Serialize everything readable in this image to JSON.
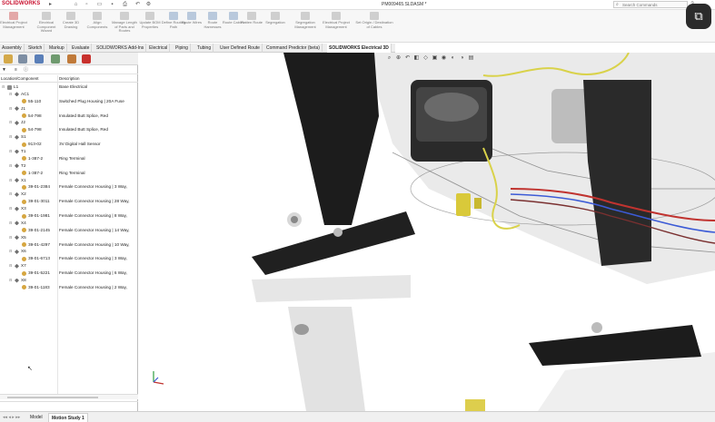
{
  "app": {
    "logo": "SOLIDWORKS",
    "document_title": "PM009465.SLDASM *",
    "search_placeholder": "Search Commands"
  },
  "ribbon": {
    "buttons": [
      {
        "label": "Electrical Project Management",
        "state": "disabled"
      },
      {
        "label": "Electrical Component Wizard",
        "state": "disabled"
      },
      {
        "label": "Create 3D Drawing",
        "state": "disabled"
      },
      {
        "label": "Align Components",
        "state": "disabled"
      },
      {
        "label": "Manage Length of Parts and Routes",
        "state": "disabled"
      },
      {
        "label": "Update BOM Properties",
        "state": "disabled"
      },
      {
        "label": "Define Routing Path",
        "state": "disabled"
      },
      {
        "label": "Route Wires",
        "state": "disabled"
      },
      {
        "label": "Route Harnesses",
        "state": "disabled"
      },
      {
        "label": "Route Cables",
        "state": "disabled"
      },
      {
        "label": "Flatten Route",
        "state": "disabled"
      },
      {
        "label": "Segregation",
        "state": "disabled"
      },
      {
        "label": "Segregation Management",
        "state": "disabled"
      },
      {
        "label": "Electrical Project Management",
        "state": "disabled"
      },
      {
        "label": "Set Origin / Destination of Cables",
        "state": "disabled"
      }
    ]
  },
  "tabs": [
    {
      "label": "Assembly"
    },
    {
      "label": "Sketch"
    },
    {
      "label": "Markup"
    },
    {
      "label": "Evaluate"
    },
    {
      "label": "SOLIDWORKS Add-Ins"
    },
    {
      "label": "Electrical"
    },
    {
      "label": "Piping"
    },
    {
      "label": "Tubing"
    },
    {
      "label": "User Defined Route"
    },
    {
      "label": "Command Predictor (beta)"
    },
    {
      "label": "SOLIDWORKS Electrical 3D",
      "active": true
    }
  ],
  "tree": {
    "col_location": "Location/Component",
    "col_description": "Description",
    "rows": [
      {
        "level": 0,
        "kind": "asm",
        "loc": "L1",
        "desc": "Base Electrical"
      },
      {
        "level": 1,
        "kind": "conn",
        "loc": "AC1",
        "desc": ""
      },
      {
        "level": 2,
        "kind": "part",
        "loc": "55-110",
        "desc": "Switched Plug Housing | 20A Fuse"
      },
      {
        "level": 1,
        "kind": "conn",
        "loc": "J1",
        "desc": ""
      },
      {
        "level": 2,
        "kind": "part",
        "loc": "54-798",
        "desc": "Insulated Butt Splice, Red"
      },
      {
        "level": 1,
        "kind": "conn",
        "loc": "J2",
        "desc": ""
      },
      {
        "level": 2,
        "kind": "part",
        "loc": "54-798",
        "desc": "Insulated Butt Splice, Red"
      },
      {
        "level": 1,
        "kind": "conn",
        "loc": "S1",
        "desc": ""
      },
      {
        "level": 2,
        "kind": "part",
        "loc": "913-02",
        "desc": "3V Digital Hall Sensor"
      },
      {
        "level": 1,
        "kind": "conn",
        "loc": "T1",
        "desc": ""
      },
      {
        "level": 2,
        "kind": "part",
        "loc": "1-387-2",
        "desc": "Ring Terminal"
      },
      {
        "level": 1,
        "kind": "conn",
        "loc": "T2",
        "desc": ""
      },
      {
        "level": 2,
        "kind": "part",
        "loc": "1-387-2",
        "desc": "Ring Terminal"
      },
      {
        "level": 1,
        "kind": "conn",
        "loc": "X1",
        "desc": ""
      },
      {
        "level": 2,
        "kind": "part",
        "loc": "39-01-2384",
        "desc": "Female Connector Housing | 3 Way,"
      },
      {
        "level": 1,
        "kind": "conn",
        "loc": "X2",
        "desc": ""
      },
      {
        "level": 2,
        "kind": "part",
        "loc": "39-01-3011",
        "desc": "Female Connector Housing | 28 Way,"
      },
      {
        "level": 1,
        "kind": "conn",
        "loc": "X3",
        "desc": ""
      },
      {
        "level": 2,
        "kind": "part",
        "loc": "39-01-1981",
        "desc": "Female Connector Housing | 8 Way,"
      },
      {
        "level": 1,
        "kind": "conn",
        "loc": "X4",
        "desc": ""
      },
      {
        "level": 2,
        "kind": "part",
        "loc": "39-01-2145",
        "desc": "Female Connector Housing | 14 Way,"
      },
      {
        "level": 1,
        "kind": "conn",
        "loc": "X5",
        "desc": ""
      },
      {
        "level": 2,
        "kind": "part",
        "loc": "39-01-4297",
        "desc": "Female Connector Housing | 10 Way,"
      },
      {
        "level": 1,
        "kind": "conn",
        "loc": "X6",
        "desc": ""
      },
      {
        "level": 2,
        "kind": "part",
        "loc": "39-01-6713",
        "desc": "Female Connector Housing | 3 Way,"
      },
      {
        "level": 1,
        "kind": "conn",
        "loc": "X7",
        "desc": ""
      },
      {
        "level": 2,
        "kind": "part",
        "loc": "39-01-5221",
        "desc": "Female Connector Housing | 6 Way,"
      },
      {
        "level": 1,
        "kind": "conn",
        "loc": "X8",
        "desc": ""
      },
      {
        "level": 2,
        "kind": "part",
        "loc": "39-01-1183",
        "desc": "Female Connector Housing | 2 Way,"
      }
    ]
  },
  "bottom_tabs": [
    {
      "label": "Model"
    },
    {
      "label": "Motion Study 1",
      "active": true
    }
  ],
  "colors": {
    "brand": "#c8102e",
    "wire_yellow": "#d9d24a",
    "wire_red": "#c0332f",
    "wire_blue": "#3c5bd6",
    "bracket": "#1f1f1f"
  }
}
